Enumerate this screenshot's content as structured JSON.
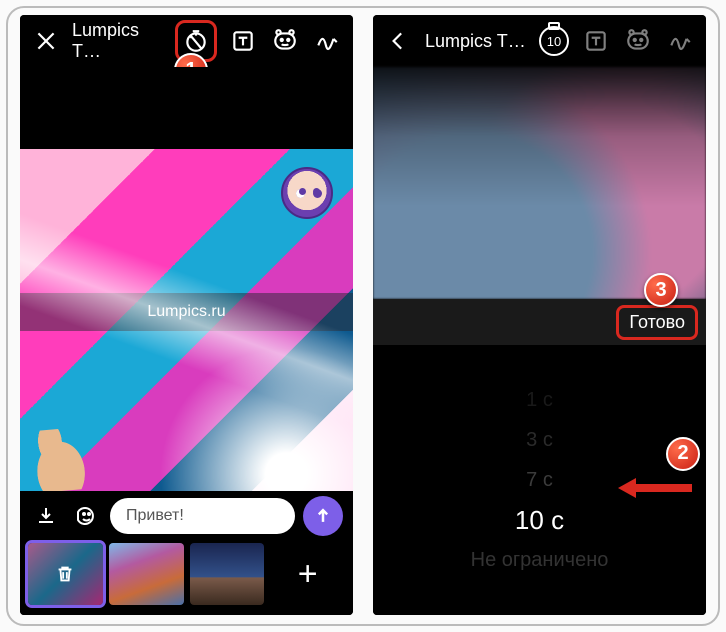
{
  "left": {
    "header": {
      "title": "Lumpics T…"
    },
    "watermark": "Lumpics.ru",
    "input_placeholder": "Привет!",
    "callout1": "1"
  },
  "right": {
    "header": {
      "title": "Lumpics T…",
      "timer_badge": "10"
    },
    "done_label": "Готово",
    "picker": {
      "opt1": "1 с",
      "opt2": "3 с",
      "opt3": "7 с",
      "opt4": "10 с",
      "opt5": "Не ограничено"
    },
    "callout2": "2",
    "callout3": "3"
  }
}
